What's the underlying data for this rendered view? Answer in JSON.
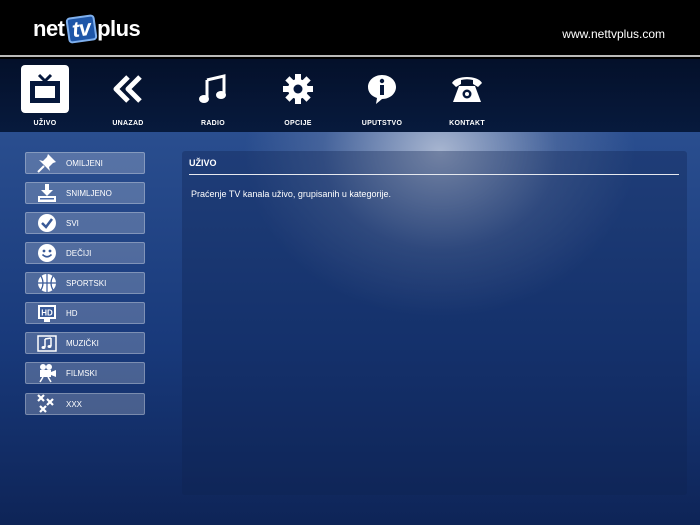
{
  "header": {
    "logo": {
      "part1": "net",
      "part2": "tv",
      "part3": "plus"
    },
    "site_url": "www.nettvplus.com"
  },
  "nav": {
    "items": [
      {
        "label": "UŽIVO",
        "icon": "tv-icon",
        "active": true
      },
      {
        "label": "UNAZAD",
        "icon": "rewind-icon"
      },
      {
        "label": "RADIO",
        "icon": "music-note-icon"
      },
      {
        "label": "OPCIJE",
        "icon": "gear-icon"
      },
      {
        "label": "UPUTSTVO",
        "icon": "info-bubble-icon"
      },
      {
        "label": "KONTAKT",
        "icon": "phone-icon"
      }
    ]
  },
  "sidebar": {
    "items": [
      {
        "label": "OMILJENI",
        "icon": "pushpin-icon"
      },
      {
        "label": "SNIMLJENO",
        "icon": "download-tray-icon"
      },
      {
        "label": "SVI",
        "icon": "check-circle-icon"
      },
      {
        "label": "DEČIJI",
        "icon": "smiley-icon"
      },
      {
        "label": "SPORTSKI",
        "icon": "basketball-icon"
      },
      {
        "label": "HD",
        "icon": "hd-icon"
      },
      {
        "label": "MUZIČKI",
        "icon": "music-notes-icon"
      },
      {
        "label": "FILMSKI",
        "icon": "movie-camera-icon"
      },
      {
        "label": "XXX",
        "icon": "xxx-icon"
      }
    ]
  },
  "panel": {
    "title": "UŽIVO",
    "description": "Praćenje TV kanala uživo, grupisanih u kategorije."
  }
}
